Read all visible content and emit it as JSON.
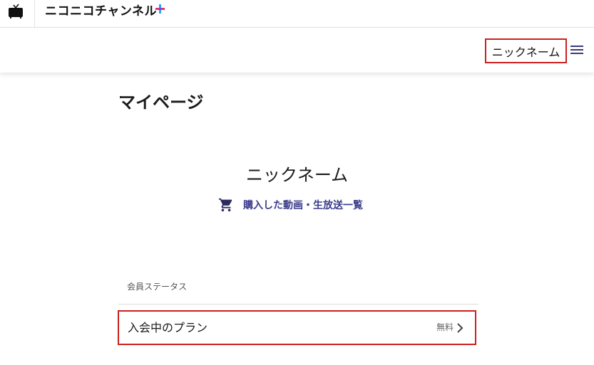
{
  "topbar": {
    "brand_name": "ニコニコチャンネル",
    "plus_icon": "plus-icon",
    "logo_icon": "tv-icon",
    "plus_colors": [
      "#2aa6f0",
      "#e6307a"
    ]
  },
  "header": {
    "nickname": "ニックネーム",
    "menu_icon": "hamburger-menu-icon"
  },
  "main": {
    "page_title": "マイページ",
    "profile_name": "ニックネーム",
    "purchase_link": {
      "icon": "cart-icon",
      "label": "購入した動画・生放送一覧"
    },
    "membership": {
      "section_label": "会員ステータス",
      "plan_label": "入会中のプラン",
      "plan_value": "無料",
      "chevron_icon": "chevron-right-icon"
    }
  },
  "colors": {
    "accent": "#3b3b8c",
    "highlight_border": "#cc1f1f"
  }
}
